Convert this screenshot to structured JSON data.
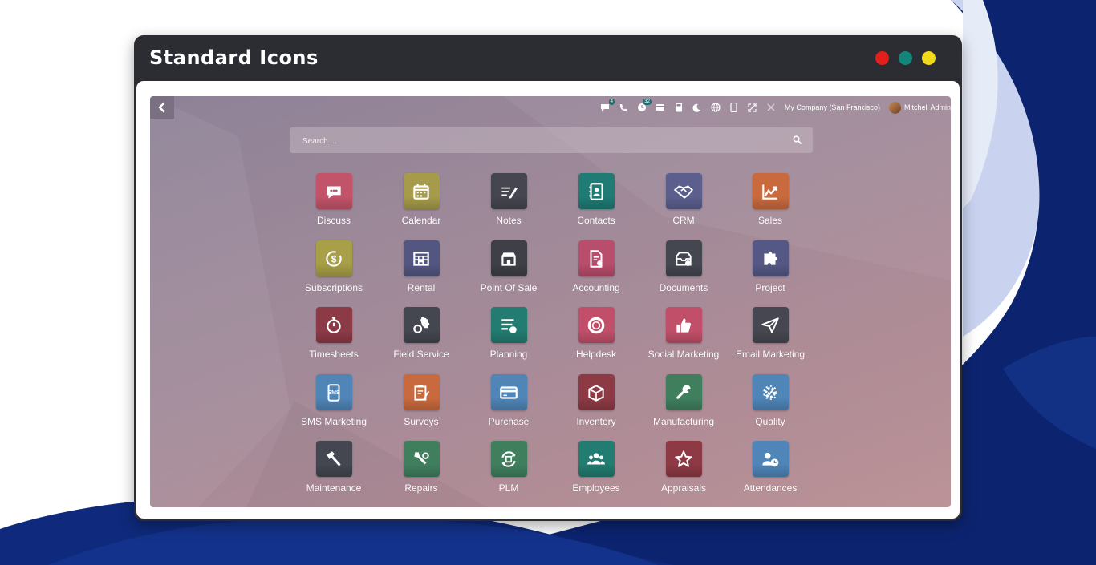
{
  "window": {
    "title": "Standard Icons",
    "dot_colors": [
      "#e0201c",
      "#14857a",
      "#f1da1c"
    ]
  },
  "topbar": {
    "discuss_badge": "4",
    "activity_badge": "32",
    "company": "My Company (San Francisco)",
    "user_name": "Mitchell Admin"
  },
  "search": {
    "placeholder": "Search ..."
  },
  "apps": [
    {
      "label": "Discuss",
      "icon": "chat-bubble-icon",
      "color": "#c2546a"
    },
    {
      "label": "Calendar",
      "icon": "calendar-icon",
      "color": "#a69b4a"
    },
    {
      "label": "Notes",
      "icon": "notes-pen-icon",
      "color": "#454650"
    },
    {
      "label": "Contacts",
      "icon": "address-book-icon",
      "color": "#1f7b74"
    },
    {
      "label": "CRM",
      "icon": "handshake-icon",
      "color": "#5c5f8e"
    },
    {
      "label": "Sales",
      "icon": "trend-chart-icon",
      "color": "#c96a3e"
    },
    {
      "label": "Subscriptions",
      "icon": "recurring-dollar-icon",
      "color": "#a89f48"
    },
    {
      "label": "Rental",
      "icon": "rental-grid-icon",
      "color": "#535680"
    },
    {
      "label": "Point Of Sale",
      "icon": "shop-icon",
      "color": "#3f4047"
    },
    {
      "label": "Accounting",
      "icon": "invoice-gear-icon",
      "color": "#b84d6c"
    },
    {
      "label": "Documents",
      "icon": "inbox-check-icon",
      "color": "#444650"
    },
    {
      "label": "Project",
      "icon": "puzzle-icon",
      "color": "#555884"
    },
    {
      "label": "Timesheets",
      "icon": "stopwatch-icon",
      "color": "#8d3a47"
    },
    {
      "label": "Field Service",
      "icon": "field-service-icon",
      "color": "#444650"
    },
    {
      "label": "Planning",
      "icon": "planning-list-icon",
      "color": "#237c71"
    },
    {
      "label": "Helpdesk",
      "icon": "lifebuoy-icon",
      "color": "#c24f6a"
    },
    {
      "label": "Social Marketing",
      "icon": "thumbs-up-icon",
      "color": "#c24f6a"
    },
    {
      "label": "Email Marketing",
      "icon": "paper-plane-icon",
      "color": "#464750"
    },
    {
      "label": "SMS Marketing",
      "icon": "sms-phone-icon",
      "color": "#4f85b7"
    },
    {
      "label": "Surveys",
      "icon": "survey-clipboard-icon",
      "color": "#c96a3e"
    },
    {
      "label": "Purchase",
      "icon": "credit-card-icon",
      "color": "#4f85b7"
    },
    {
      "label": "Inventory",
      "icon": "box-icon",
      "color": "#8e3a44"
    },
    {
      "label": "Manufacturing",
      "icon": "wrench-icon",
      "color": "#3f7f5e"
    },
    {
      "label": "Quality",
      "icon": "quality-gear-icon",
      "color": "#4f85b7"
    },
    {
      "label": "Maintenance",
      "icon": "hammer-icon",
      "color": "#444650"
    },
    {
      "label": "Repairs",
      "icon": "repairs-tools-icon",
      "color": "#3f7f5e"
    },
    {
      "label": "PLM",
      "icon": "plm-cycle-icon",
      "color": "#3f7f5e"
    },
    {
      "label": "Employees",
      "icon": "people-group-icon",
      "color": "#237c71"
    },
    {
      "label": "Appraisals",
      "icon": "star-badge-icon",
      "color": "#8e3a44"
    },
    {
      "label": "Attendances",
      "icon": "person-clock-icon",
      "color": "#4f85b7"
    }
  ]
}
